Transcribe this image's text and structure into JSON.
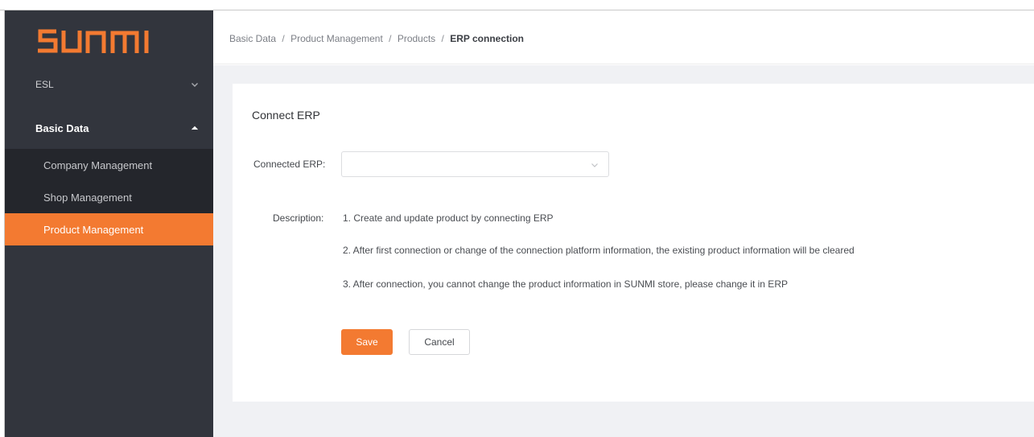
{
  "brand": {
    "logo_text": "SUNMI",
    "accent_color": "#f37a31"
  },
  "sidebar": {
    "groups": [
      {
        "label": "ESL",
        "icon": "chevron-down-icon"
      },
      {
        "label": "Basic Data",
        "icon": "chevron-up-icon"
      }
    ],
    "subitems": [
      {
        "label": "Company Management"
      },
      {
        "label": "Shop Management"
      },
      {
        "label": "Product Management"
      }
    ]
  },
  "breadcrumb": {
    "items": [
      "Basic Data",
      "Product Management",
      "Products"
    ],
    "current": "ERP connection",
    "separator": "/"
  },
  "form": {
    "title": "Connect ERP",
    "connected_erp_label": "Connected ERP:",
    "connected_erp_value": "",
    "description_label": "Description:",
    "description_lines": [
      "1. Create and update product by connecting ERP",
      "2. After first connection or change of the connection platform information, the existing product information will be cleared",
      "3. After connection, you cannot change the product information in SUNMI store, please change it in ERP"
    ],
    "save_label": "Save",
    "cancel_label": "Cancel"
  }
}
